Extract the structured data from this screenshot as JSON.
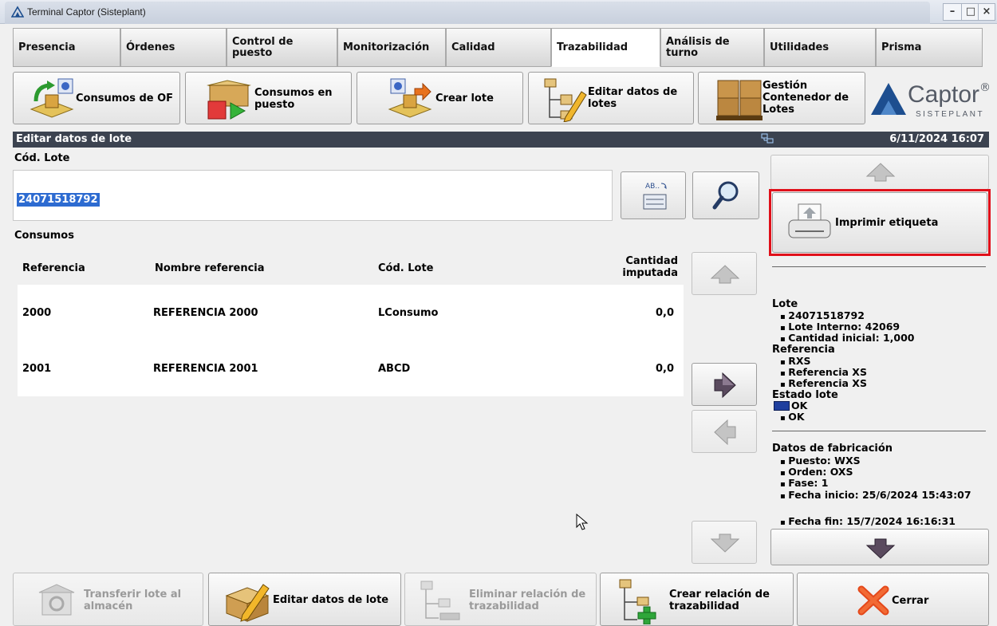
{
  "window": {
    "title": "Terminal Captor (Sisteplant)",
    "controls": {
      "minimize": "–",
      "maximize": "□",
      "close": "×"
    }
  },
  "tabs": [
    {
      "label": "Presencia"
    },
    {
      "label": "Órdenes"
    },
    {
      "label": "Control de puesto"
    },
    {
      "label": "Monitorización"
    },
    {
      "label": "Calidad"
    },
    {
      "label": "Trazabilidad",
      "active": true
    },
    {
      "label": "Análisis de turno"
    },
    {
      "label": "Utilidades"
    },
    {
      "label": "Prisma"
    }
  ],
  "toolbar": {
    "consumos_of": "Consumos de OF",
    "consumos_puesto": "Consumos en puesto",
    "crear_lote": "Crear lote",
    "editar_datos_lotes": "Editar datos de lotes",
    "gestion_contenedor": "Gestión Contenedor de Lotes"
  },
  "logo": {
    "brand": "Captor",
    "reg": "®",
    "sub": "SISTEPLANT"
  },
  "section": {
    "title": "Editar datos de lote",
    "datetime": "6/11/2024 16:07",
    "network_icon": "network-icon"
  },
  "form": {
    "lote_label": "Cód. Lote",
    "lote_value": "24071518792",
    "consumos_label": "Consumos"
  },
  "table": {
    "headers": {
      "referencia": "Referencia",
      "nombre": "Nombre referencia",
      "cod_lote": "Cód. Lote",
      "cantidad": "Cantidad imputada"
    },
    "rows": [
      {
        "referencia": "2000",
        "nombre": "REFERENCIA 2000",
        "cod_lote": "LConsumo",
        "cantidad": "0,0"
      },
      {
        "referencia": "2001",
        "nombre": "REFERENCIA 2001",
        "cod_lote": "ABCD",
        "cantidad": "0,0"
      }
    ]
  },
  "right_panel": {
    "print_label": "Imprimir etiqueta",
    "highlight_color": "#e0101a"
  },
  "info": {
    "lote_title": "Lote",
    "lote_items": [
      "24071518792",
      "Lote Interno: 42069",
      "Cantidad inicial: 1,000"
    ],
    "ref_title": "Referencia",
    "ref_items": [
      "RXS",
      "Referencia XS",
      "Referencia XS"
    ],
    "estado_title": "Estado lote",
    "estado_color": "#1f3f9e",
    "estado_color_label": "OK",
    "estado_items": [
      "OK"
    ],
    "fab_title": "Datos de fabricación",
    "fab_items": [
      "Puesto: WXS",
      "Orden: OXS",
      "Fase: 1",
      "Fecha inicio: 25/6/2024 15:43:07",
      "Fecha fin: 15/7/2024 16:16:31"
    ]
  },
  "bottom": {
    "transferir": "Transferir lote al almacén",
    "editar": "Editar datos de lote",
    "eliminar": "Eliminar relación de trazabilidad",
    "crear_relacion": "Crear relación de trazabilidad",
    "cerrar": "Cerrar"
  }
}
